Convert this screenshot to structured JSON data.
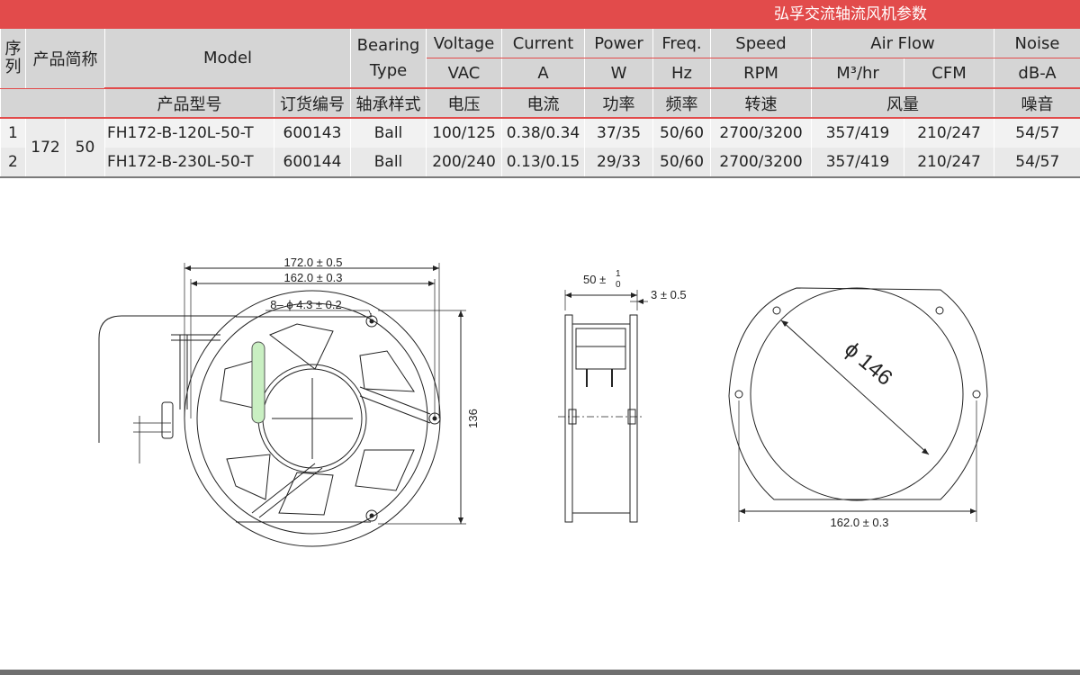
{
  "banner_title": "弘孚交流轴流风机参数",
  "header": {
    "seq": "序列",
    "product_short": "产品简称",
    "model": "Model",
    "bearing_en": "Bearing Type",
    "voltage_en": "Voltage",
    "current_en": "Current",
    "power_en": "Power",
    "freq_en": "Freq.",
    "speed_en": "Speed",
    "airflow_en": "Air Flow",
    "noise_en": "Noise",
    "voltage_unit": "VAC",
    "current_unit": "A",
    "power_unit": "W",
    "freq_unit": "Hz",
    "speed_unit": "RPM",
    "airflow_unit1": "M³/hr",
    "airflow_unit2": "CFM",
    "noise_unit": "dB-A",
    "model_cn": "产品型号",
    "order_cn": "订货编号",
    "bearing_cn": "轴承样式",
    "voltage_cn": "电压",
    "current_cn": "电流",
    "power_cn": "功率",
    "freq_cn": "频率",
    "speed_cn": "转速",
    "airflow_cn": "风量",
    "noise_cn": "噪音"
  },
  "group": {
    "size": "172",
    "thickness": "50"
  },
  "rows": [
    {
      "seq": "1",
      "model": "FH172-B-120L-50-T",
      "order": "600143",
      "bearing": "Ball",
      "voltage": "100/125",
      "current": "0.38/0.34",
      "power": "37/35",
      "freq": "50/60",
      "speed": "2700/3200",
      "m3hr": "357/419",
      "cfm": "210/247",
      "noise": "54/57"
    },
    {
      "seq": "2",
      "model": "FH172-B-230L-50-T",
      "order": "600144",
      "bearing": "Ball",
      "voltage": "200/240",
      "current": "0.13/0.15",
      "power": "29/33",
      "freq": "50/60",
      "speed": "2700/3200",
      "m3hr": "357/419",
      "cfm": "210/247",
      "noise": "54/57"
    }
  ],
  "drawing": {
    "dim_outer_width": "172.0 ± 0.5",
    "dim_hole_spacing": "162.0 ± 0.3",
    "dim_holes": "8– ϕ 4.3 ± 0.2",
    "dim_height": "136",
    "dim_depth": "50 ±",
    "dim_depth_tol_upper": "1",
    "dim_depth_tol_lower": "0",
    "dim_flange": "3 ± 0.5",
    "dim_diameter": "ϕ 146",
    "dim_back_spacing": "162.0 ± 0.3"
  },
  "colors": {
    "banner": "#e24b4b",
    "header_bg": "#d5d5d5",
    "wire_highlight": "#c9efc2"
  }
}
